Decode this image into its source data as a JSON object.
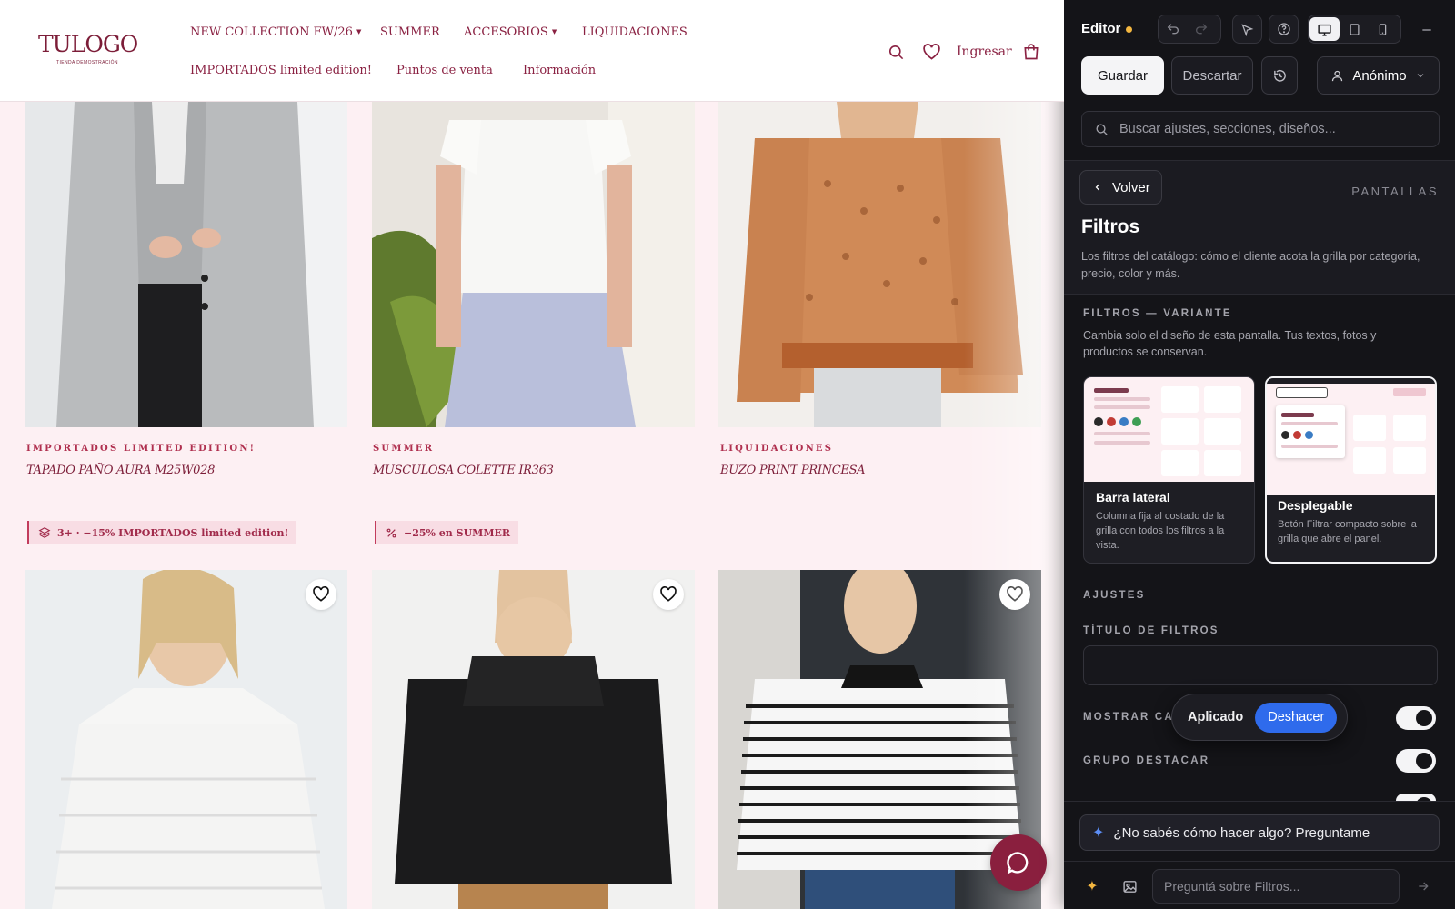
{
  "store": {
    "logo": {
      "name": "TULOGO",
      "tagline": "TIENDA DEMOSTRACIÓN"
    },
    "nav_row1": [
      "NEW COLLECTION FW/26",
      "SUMMER",
      "ACCESORIOS",
      "LIQUIDACIONES"
    ],
    "nav_row2": [
      "IMPORTADOS limited edition!",
      "Puntos de venta",
      "Información"
    ],
    "login_label": "Ingresar",
    "icons": [
      "search-icon",
      "heart-icon",
      "cart-icon",
      "chat-icon"
    ],
    "products": [
      {
        "category": "IMPORTADOS LIMITED EDITION!",
        "name": "TAPADO PAÑO AURA M25W028",
        "promo": "3+ · −15% IMPORTADOS limited edition!"
      },
      {
        "category": "SUMMER",
        "name": "MUSCULOSA COLETTE IR363",
        "promo": "−25% en SUMMER"
      },
      {
        "category": "LIQUIDACIONES",
        "name": "BUZO PRINT PRINCESA",
        "promo": ""
      }
    ],
    "colors": {
      "brand": "#8a2142",
      "background": "#fdf0f3",
      "promo_bg": "#f8dde4"
    }
  },
  "editor": {
    "title": "Editor",
    "save_label": "Guardar",
    "discard_label": "Descartar",
    "user_label": "Anónimo",
    "search_placeholder": "Buscar ajustes, secciones, diseños...",
    "back_label": "Volver",
    "screens_label": "PANTALLAS",
    "section_title": "Filtros",
    "section_desc": "Los filtros del catálogo: cómo el cliente acota la grilla por categoría, precio, color y más.",
    "variant_label": "FILTROS — VARIANTE",
    "variant_desc": "Cambia solo el diseño de esta pantalla. Tus textos, fotos y productos se conservan.",
    "variants": [
      {
        "name": "Barra lateral",
        "desc": "Columna fija al costado de la grilla con todos los filtros a la vista.",
        "selected": false
      },
      {
        "name": "Desplegable",
        "desc": "Botón Filtrar compacto sobre la grilla que abre el panel.",
        "selected": true
      }
    ],
    "settings_label": "AJUSTES",
    "filters_title_label": "TÍTULO DE FILTROS",
    "filters_title_value": "",
    "show_label": "MOSTRAR CAN",
    "group_label": "GRUPO DESTACAR",
    "toast_text": "Aplicado",
    "undo_label": "Deshacer",
    "ai_prompt": "¿No sabés cómo hacer algo? Preguntame",
    "ask_placeholder": "Preguntá sobre Filtros...",
    "colors": {
      "panel": "#141418",
      "accent": "#2f6bec",
      "unsaved_dot": "#f4b740"
    }
  }
}
